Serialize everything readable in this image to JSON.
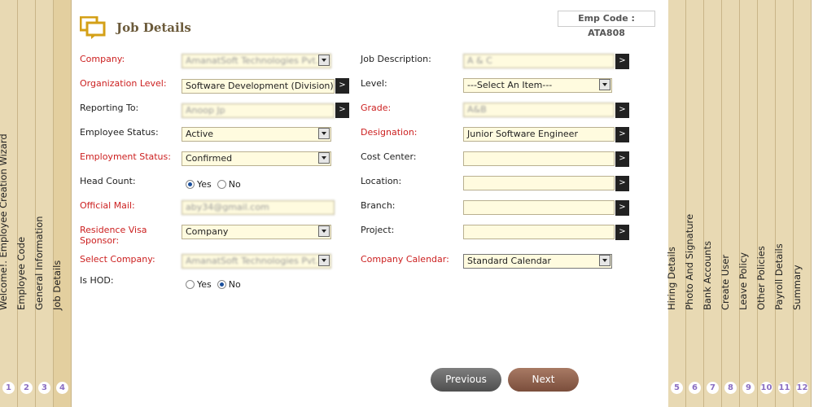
{
  "left_tabs": [
    {
      "num": "1",
      "label": "Welcome!. Employee Creation Wizard"
    },
    {
      "num": "2",
      "label": "Employee Code"
    },
    {
      "num": "3",
      "label": "General Information"
    },
    {
      "num": "4",
      "label": "Job Details"
    }
  ],
  "right_tabs": [
    {
      "num": "5",
      "label": "Hiring Details"
    },
    {
      "num": "6",
      "label": "Photo And Signature"
    },
    {
      "num": "7",
      "label": "Bank Accounts"
    },
    {
      "num": "8",
      "label": "Create User"
    },
    {
      "num": "9",
      "label": "Leave Policy"
    },
    {
      "num": "10",
      "label": "Other Policies"
    },
    {
      "num": "11",
      "label": "Payroll Details"
    },
    {
      "num": "12",
      "label": "Summary"
    }
  ],
  "header": {
    "title": "Job Details",
    "emp_code": "Emp Code : ATA808"
  },
  "form_left": {
    "company": {
      "label": "Company:",
      "value": "AmanatSoft Technologies Pvt. Ltd"
    },
    "org_level": {
      "label": "Organization Level:",
      "value": "Software Development (Division)"
    },
    "reporting_to": {
      "label": "Reporting To:",
      "value": "Anoop Jp"
    },
    "employee_status": {
      "label": "Employee Status:",
      "value": "Active"
    },
    "employment_status": {
      "label": "Employment Status:",
      "value": "Confirmed"
    },
    "head_count": {
      "label": "Head Count:",
      "yes": "Yes",
      "no": "No"
    },
    "official_mail": {
      "label": "Official Mail:",
      "value": "aby34@gmail.com"
    },
    "visa_sponsor": {
      "label": "Residence Visa Sponsor:",
      "value": "Company"
    },
    "select_company": {
      "label": "Select Company:",
      "value": "AmanatSoft Technologies Pvt. Ltd"
    },
    "is_hod": {
      "label": "Is HOD:",
      "yes": "Yes",
      "no": "No"
    }
  },
  "form_right": {
    "job_description": {
      "label": "Job Description:",
      "value": "A & C"
    },
    "level": {
      "label": "Level:",
      "value": "---Select An Item---"
    },
    "grade": {
      "label": "Grade:",
      "value": "A&B"
    },
    "designation": {
      "label": "Designation:",
      "value": "Junior Software Engineer"
    },
    "cost_center": {
      "label": "Cost Center:",
      "value": ""
    },
    "location": {
      "label": "Location:",
      "value": ""
    },
    "branch": {
      "label": "Branch:",
      "value": ""
    },
    "project": {
      "label": "Project:",
      "value": ""
    },
    "company_calendar": {
      "label": "Company Calendar:",
      "value": "Standard Calendar"
    }
  },
  "buttons": {
    "previous": "Previous",
    "next": "Next",
    "go": ">"
  },
  "colors": {
    "required_label": "#cc1f1f",
    "tab_bg": "#e8d9b3",
    "field_bg": "#fffbdf"
  }
}
